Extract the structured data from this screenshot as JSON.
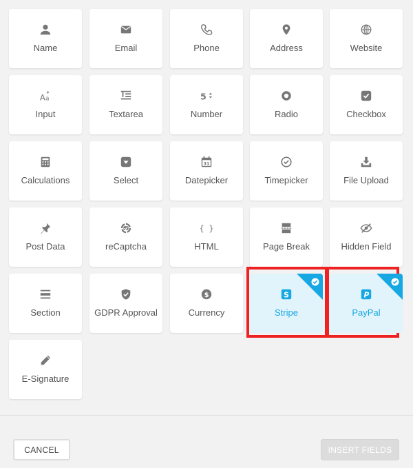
{
  "fields": [
    {
      "label": "Name",
      "icon": "user-icon"
    },
    {
      "label": "Email",
      "icon": "envelope-icon"
    },
    {
      "label": "Phone",
      "icon": "phone-icon"
    },
    {
      "label": "Address",
      "icon": "map-pin-icon"
    },
    {
      "label": "Website",
      "icon": "globe-icon"
    },
    {
      "label": "Input",
      "icon": "text-size-icon"
    },
    {
      "label": "Textarea",
      "icon": "textarea-icon"
    },
    {
      "label": "Number",
      "icon": "number-icon"
    },
    {
      "label": "Radio",
      "icon": "radio-icon"
    },
    {
      "label": "Checkbox",
      "icon": "checkbox-icon"
    },
    {
      "label": "Calculations",
      "icon": "calculator-icon"
    },
    {
      "label": "Select",
      "icon": "select-dropdown-icon"
    },
    {
      "label": "Datepicker",
      "icon": "calendar-icon"
    },
    {
      "label": "Timepicker",
      "icon": "clock-icon"
    },
    {
      "label": "File Upload",
      "icon": "upload-icon"
    },
    {
      "label": "Post Data",
      "icon": "pin-icon"
    },
    {
      "label": "reCaptcha",
      "icon": "recaptcha-icon"
    },
    {
      "label": "HTML",
      "icon": "code-braces-icon"
    },
    {
      "label": "Page Break",
      "icon": "page-break-icon"
    },
    {
      "label": "Hidden Field",
      "icon": "eye-off-icon"
    },
    {
      "label": "Section",
      "icon": "section-icon"
    },
    {
      "label": "GDPR Approval",
      "icon": "shield-check-icon"
    },
    {
      "label": "Currency",
      "icon": "dollar-icon"
    },
    {
      "label": "Stripe",
      "icon": "stripe-icon",
      "selected": true
    },
    {
      "label": "PayPal",
      "icon": "paypal-icon",
      "selected": true
    },
    {
      "label": "E-Signature",
      "icon": "pen-icon"
    }
  ],
  "footer": {
    "cancel_label": "CANCEL",
    "insert_label": "INSERT FIELDS"
  },
  "colors": {
    "accent": "#17a8e3",
    "selected_bg": "#e1f3fb",
    "icon_gray": "#777777",
    "highlight": "#ee2222"
  }
}
